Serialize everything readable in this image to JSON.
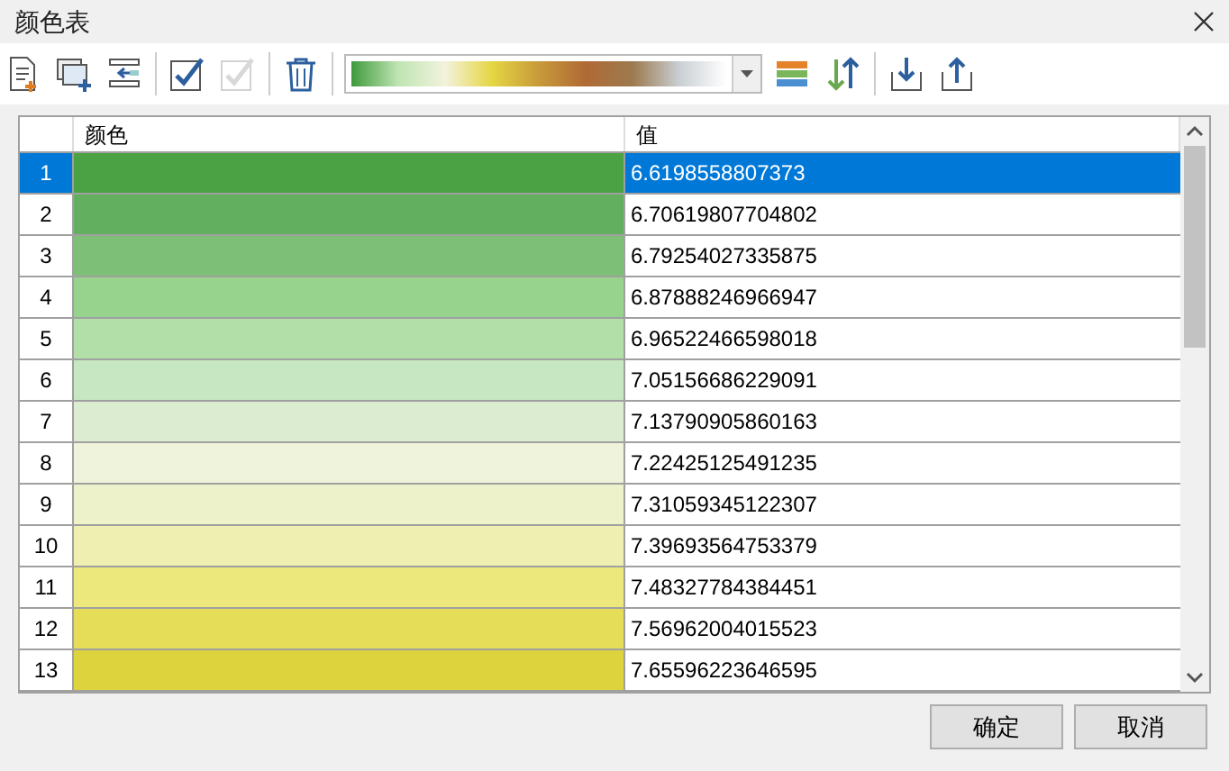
{
  "window": {
    "title": "颜色表"
  },
  "toolbar": [
    {
      "kind": "new-doc",
      "disabled": false
    },
    {
      "kind": "add-window",
      "disabled": false
    },
    {
      "kind": "list-arrow",
      "disabled": false
    },
    {
      "kind": "sep"
    },
    {
      "kind": "check",
      "disabled": false
    },
    {
      "kind": "check",
      "disabled": true
    },
    {
      "kind": "sep"
    },
    {
      "kind": "trash",
      "disabled": false
    },
    {
      "kind": "sep"
    },
    {
      "kind": "ramp"
    },
    {
      "kind": "stripes",
      "disabled": false
    },
    {
      "kind": "sort",
      "disabled": false
    },
    {
      "kind": "sep"
    },
    {
      "kind": "import",
      "disabled": false
    },
    {
      "kind": "export",
      "disabled": false
    }
  ],
  "table": {
    "columns": [
      "颜色",
      "值"
    ],
    "rows": [
      {
        "index": "1",
        "color": "#4aa244",
        "value": "6.6198558807373",
        "selected": true
      },
      {
        "index": "2",
        "color": "#62af5f",
        "value": "6.70619807704802",
        "selected": false
      },
      {
        "index": "3",
        "color": "#7dbf76",
        "value": "6.79254027335875",
        "selected": false
      },
      {
        "index": "4",
        "color": "#98d38d",
        "value": "6.87888246966947",
        "selected": false
      },
      {
        "index": "5",
        "color": "#b1dfa7",
        "value": "6.96522466598018",
        "selected": false
      },
      {
        "index": "6",
        "color": "#c7e6c2",
        "value": "7.05156686229091",
        "selected": false
      },
      {
        "index": "7",
        "color": "#dcecd1",
        "value": "7.13790905860163",
        "selected": false
      },
      {
        "index": "8",
        "color": "#f0f3dc",
        "value": "7.22425125491235",
        "selected": false
      },
      {
        "index": "9",
        "color": "#edf2cb",
        "value": "7.31059345122307",
        "selected": false
      },
      {
        "index": "10",
        "color": "#eeefb1",
        "value": "7.39693564753379",
        "selected": false
      },
      {
        "index": "11",
        "color": "#ede87c",
        "value": "7.48327784384451",
        "selected": false
      },
      {
        "index": "12",
        "color": "#e5dd57",
        "value": "7.56962004015523",
        "selected": false
      },
      {
        "index": "13",
        "color": "#ddd33d",
        "value": "7.65596223646595",
        "selected": false
      }
    ]
  },
  "buttons": [
    "确定",
    "取消"
  ]
}
